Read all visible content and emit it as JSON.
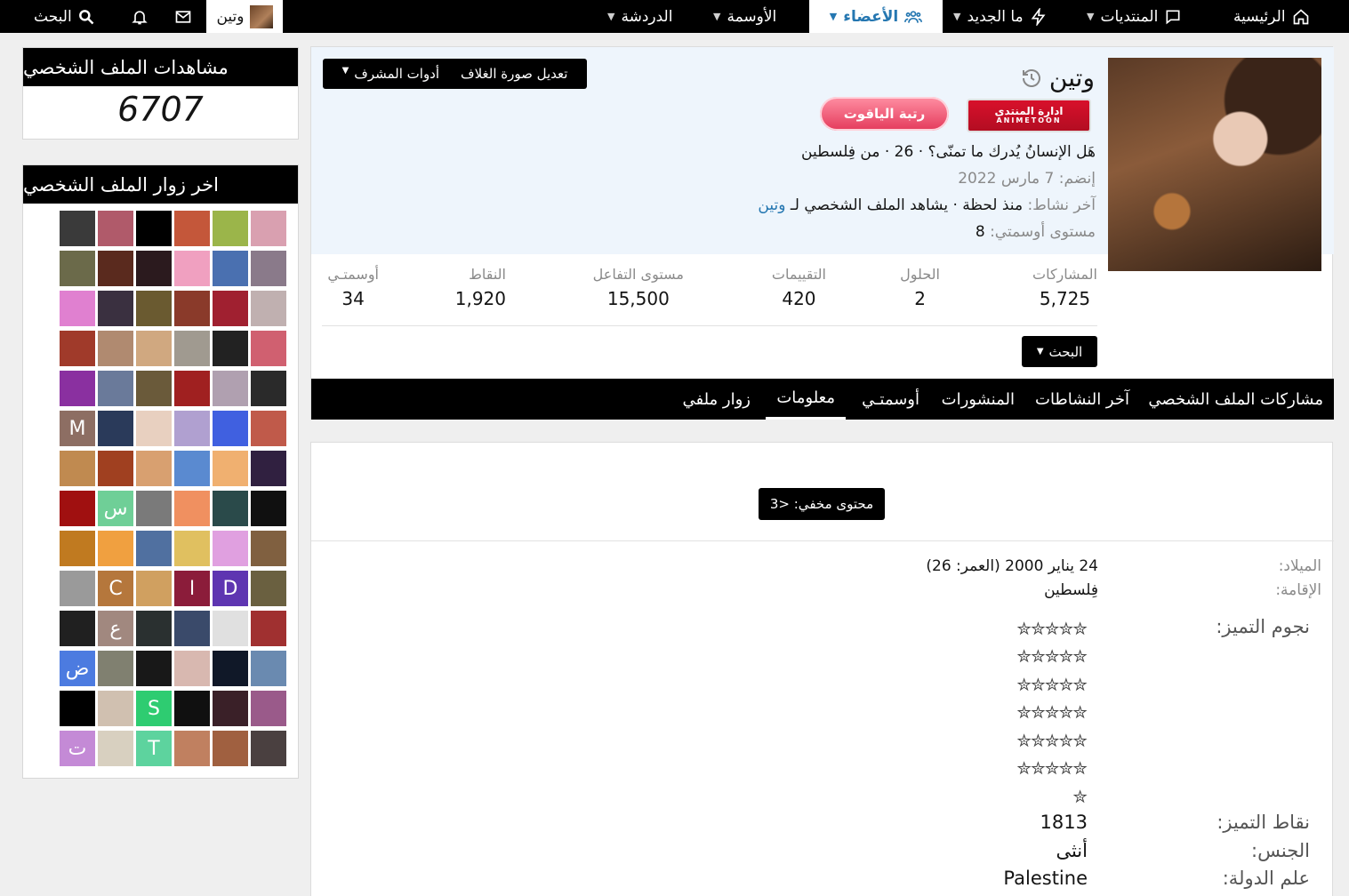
{
  "nav": {
    "home": "الرئيسية",
    "forums": "المنتديات",
    "whats_new": "ما الجديد",
    "members": "الأعضاء",
    "badges": "الأوسمة",
    "chat": "الدردشة",
    "username": "وتين",
    "search": "البحث"
  },
  "profile": {
    "name": "وتين",
    "edit_cover": "تعديل صورة الغلاف",
    "mod_tools": "أدوات المشرف",
    "badge_admin": "ادارة المنتدى",
    "badge_admin_sub": "ANIMETOON",
    "badge_rank": "رتبة الياقوت",
    "tagline": "هَل الإنسانُ يُدرك ما تمنّى؟ · 26 · من فِلسطين",
    "joined_label": "إنضم:",
    "joined_value": "7 مارس 2022",
    "last_active_label": "آخر نشاط:",
    "last_active_value": "منذ لحظة · يشاهد الملف الشخصي لـ",
    "last_active_link": "وتين",
    "badge_level_label": "مستوى أوسمتي:",
    "badge_level_value": "8",
    "search_button": "البحث"
  },
  "stats": [
    {
      "label": "المشاركات",
      "value": "5,725"
    },
    {
      "label": "الحلول",
      "value": "2"
    },
    {
      "label": "التقييمات",
      "value": "420"
    },
    {
      "label": "مستوى التفاعل",
      "value": "15,500"
    },
    {
      "label": "النقاط",
      "value": "1,920"
    },
    {
      "label": "أوسمتـي",
      "value": "34"
    }
  ],
  "tabs": [
    "مشاركات الملف الشخصي",
    "آخر النشاطات",
    "المنشورات",
    "أوسمتـي",
    "معلومات",
    "زوار ملفي"
  ],
  "info": {
    "hidden_content": "محتوى مخفي: <3",
    "birth_label": "الميلاد:",
    "birth_value": "24 يناير 2000 (العمر: 26)",
    "location_label": "الإقامة:",
    "location_value": "فِلسطين",
    "stars_label": "نجوم التميز:",
    "stars_rows": [
      "✮✮✮✮✮",
      "✮✮✮✮✮",
      "✮✮✮✮✮",
      "✮✮✮✮✮",
      "✮✮✮✮✮",
      "✮✮✮✮✮",
      "✮"
    ],
    "points_label": "نقاط التميز:",
    "points_value": "1813",
    "gender_label": "الجنس:",
    "gender_value": "أنثى",
    "flag_label": "علم الدولة:",
    "flag_value": "Palestine"
  },
  "sidebar": {
    "views_title": "مشاهدات الملف الشخصي",
    "views_count": "6707",
    "visitors_title": "اخر زوار الملف الشخصي",
    "visitors": [
      {
        "letter": "",
        "color": "#3a3a3a"
      },
      {
        "letter": "",
        "color": "#b05a6a"
      },
      {
        "letter": "",
        "color": "#000000"
      },
      {
        "letter": "",
        "color": "#c4573a"
      },
      {
        "letter": "",
        "color": "#9bb54a"
      },
      {
        "letter": "",
        "color": "#d9a0b0"
      },
      {
        "letter": "",
        "color": "#6b6a4a"
      },
      {
        "letter": "",
        "color": "#5a2a1e"
      },
      {
        "letter": "",
        "color": "#2b1a1e"
      },
      {
        "letter": "",
        "color": "#f0a0c0"
      },
      {
        "letter": "",
        "color": "#4a70b0"
      },
      {
        "letter": "",
        "color": "#8a7a8a"
      },
      {
        "letter": "",
        "color": "#e080d0"
      },
      {
        "letter": "",
        "color": "#3a3040"
      },
      {
        "letter": "",
        "color": "#6a5a30"
      },
      {
        "letter": "",
        "color": "#8a3a2a"
      },
      {
        "letter": "",
        "color": "#a02030"
      },
      {
        "letter": "",
        "color": "#c0b0b0"
      },
      {
        "letter": "",
        "color": "#a03a2a"
      },
      {
        "letter": "",
        "color": "#b08a70"
      },
      {
        "letter": "",
        "color": "#d0a880"
      },
      {
        "letter": "",
        "color": "#a09a90"
      },
      {
        "letter": "",
        "color": "#222222"
      },
      {
        "letter": "",
        "color": "#d06070"
      },
      {
        "letter": "",
        "color": "#8a30a0"
      },
      {
        "letter": "",
        "color": "#6a7a9a"
      },
      {
        "letter": "",
        "color": "#6a5a3a"
      },
      {
        "letter": "",
        "color": "#a02020"
      },
      {
        "letter": "",
        "color": "#b0a0b0"
      },
      {
        "letter": "",
        "color": "#2a2a2a"
      },
      {
        "letter": "M",
        "color": "#8d6e63"
      },
      {
        "letter": "",
        "color": "#2a3a5a"
      },
      {
        "letter": "",
        "color": "#e8d0c0"
      },
      {
        "letter": "",
        "color": "#b0a0d0"
      },
      {
        "letter": "",
        "color": "#4060e0"
      },
      {
        "letter": "",
        "color": "#c05a4a"
      },
      {
        "letter": "",
        "color": "#c08a50"
      },
      {
        "letter": "",
        "color": "#a04020"
      },
      {
        "letter": "",
        "color": "#d8a070"
      },
      {
        "letter": "",
        "color": "#5a8ad0"
      },
      {
        "letter": "",
        "color": "#f0b070"
      },
      {
        "letter": "",
        "color": "#302040"
      },
      {
        "letter": "",
        "color": "#a01010"
      },
      {
        "letter": "س",
        "color": "#6fcf97"
      },
      {
        "letter": "",
        "color": "#7a7a7a"
      },
      {
        "letter": "",
        "color": "#f09060"
      },
      {
        "letter": "",
        "color": "#2a4a4a"
      },
      {
        "letter": "",
        "color": "#101010"
      },
      {
        "letter": "",
        "color": "#c07a20"
      },
      {
        "letter": "",
        "color": "#f0a040"
      },
      {
        "letter": "",
        "color": "#5070a0"
      },
      {
        "letter": "",
        "color": "#e0c060"
      },
      {
        "letter": "",
        "color": "#e0a0e0"
      },
      {
        "letter": "",
        "color": "#806040"
      },
      {
        "letter": "",
        "color": "#9a9a9a"
      },
      {
        "letter": "C",
        "color": "#b5773c"
      },
      {
        "letter": "",
        "color": "#d0a060"
      },
      {
        "letter": "ا",
        "color": "#8b1c3a"
      },
      {
        "letter": "D",
        "color": "#5e35b1"
      },
      {
        "letter": "",
        "color": "#6a6040"
      },
      {
        "letter": "",
        "color": "#202020"
      },
      {
        "letter": "ع",
        "color": "#a1887f"
      },
      {
        "letter": "",
        "color": "#2a3030"
      },
      {
        "letter": "",
        "color": "#3a4a6a"
      },
      {
        "letter": "",
        "color": "#e0e0e0"
      },
      {
        "letter": "",
        "color": "#a03030"
      },
      {
        "letter": "ض",
        "color": "#4c7be0"
      },
      {
        "letter": "",
        "color": "#808070"
      },
      {
        "letter": "",
        "color": "#181818"
      },
      {
        "letter": "",
        "color": "#d8b8b0"
      },
      {
        "letter": "",
        "color": "#101828"
      },
      {
        "letter": "",
        "color": "#6a8ab0"
      },
      {
        "letter": "",
        "color": "#000000"
      },
      {
        "letter": "",
        "color": "#d0c0b0"
      },
      {
        "letter": "S",
        "color": "#2ecc71"
      },
      {
        "letter": "",
        "color": "#101010"
      },
      {
        "letter": "",
        "color": "#3a2028"
      },
      {
        "letter": "",
        "color": "#9a5a8a"
      },
      {
        "letter": "ت",
        "color": "#c48ad6"
      },
      {
        "letter": "",
        "color": "#d8d0c0"
      },
      {
        "letter": "T",
        "color": "#5dd39e"
      },
      {
        "letter": "",
        "color": "#c08060"
      },
      {
        "letter": "",
        "color": "#a06040"
      },
      {
        "letter": "",
        "color": "#4a4040"
      }
    ]
  },
  "colors": {
    "link": "#2577b1",
    "header_bg": "#eef5fc",
    "bar": "#000000"
  }
}
